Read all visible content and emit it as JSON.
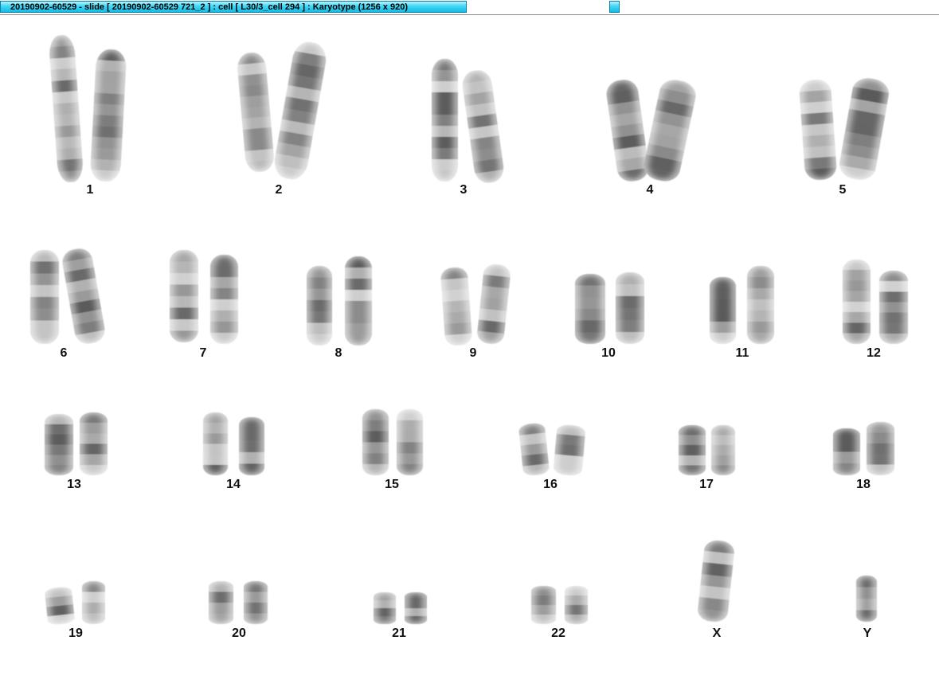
{
  "window": {
    "title": "20190902-60529 - slide [ 20190902-60529 721_2 ] : cell [ L30/3_cell 294 ] : Karyotype  (1256 x 920)"
  },
  "colors": {
    "titlebar": "#3fd6f5",
    "chromosome_dark": "#3a3a3a",
    "chromosome_light": "#d8d8d8",
    "background": "#ffffff"
  },
  "karyotype": {
    "chromosomes": [
      {
        "label": "1"
      },
      {
        "label": "2"
      },
      {
        "label": "3"
      },
      {
        "label": "4"
      },
      {
        "label": "5"
      },
      {
        "label": "6"
      },
      {
        "label": "7"
      },
      {
        "label": "8"
      },
      {
        "label": "9"
      },
      {
        "label": "10"
      },
      {
        "label": "11"
      },
      {
        "label": "12"
      },
      {
        "label": "13"
      },
      {
        "label": "14"
      },
      {
        "label": "15"
      },
      {
        "label": "16"
      },
      {
        "label": "17"
      },
      {
        "label": "18"
      },
      {
        "label": "19"
      },
      {
        "label": "20"
      },
      {
        "label": "21"
      },
      {
        "label": "22"
      },
      {
        "label": "X"
      },
      {
        "label": "Y"
      }
    ]
  }
}
